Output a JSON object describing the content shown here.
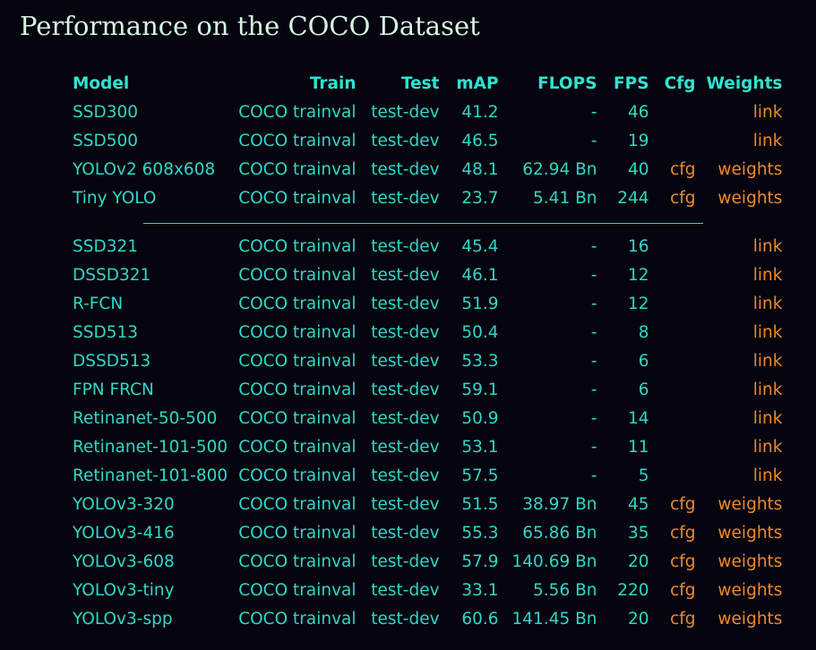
{
  "title": "Performance on the COCO Dataset",
  "headers": {
    "model": "Model",
    "train": "Train",
    "test": "Test",
    "map": "mAP",
    "flops": "FLOPS",
    "fps": "FPS",
    "cfg": "Cfg",
    "weights": "Weights"
  },
  "rows_group1": [
    {
      "model": "SSD300",
      "train": "COCO trainval",
      "test": "test-dev",
      "map": "41.2",
      "flops": "-",
      "fps": "46",
      "cfg": "",
      "weights": "link"
    },
    {
      "model": "SSD500",
      "train": "COCO trainval",
      "test": "test-dev",
      "map": "46.5",
      "flops": "-",
      "fps": "19",
      "cfg": "",
      "weights": "link"
    },
    {
      "model": "YOLOv2 608x608",
      "train": "COCO trainval",
      "test": "test-dev",
      "map": "48.1",
      "flops": "62.94 Bn",
      "fps": "40",
      "cfg": "cfg",
      "weights": "weights"
    },
    {
      "model": "Tiny YOLO",
      "train": "COCO trainval",
      "test": "test-dev",
      "map": "23.7",
      "flops": "5.41 Bn",
      "fps": "244",
      "cfg": "cfg",
      "weights": "weights"
    }
  ],
  "rows_group2": [
    {
      "model": "SSD321",
      "train": "COCO trainval",
      "test": "test-dev",
      "map": "45.4",
      "flops": "-",
      "fps": "16",
      "cfg": "",
      "weights": "link"
    },
    {
      "model": "DSSD321",
      "train": "COCO trainval",
      "test": "test-dev",
      "map": "46.1",
      "flops": "-",
      "fps": "12",
      "cfg": "",
      "weights": "link"
    },
    {
      "model": "R-FCN",
      "train": "COCO trainval",
      "test": "test-dev",
      "map": "51.9",
      "flops": "-",
      "fps": "12",
      "cfg": "",
      "weights": "link"
    },
    {
      "model": "SSD513",
      "train": "COCO trainval",
      "test": "test-dev",
      "map": "50.4",
      "flops": "-",
      "fps": "8",
      "cfg": "",
      "weights": "link"
    },
    {
      "model": "DSSD513",
      "train": "COCO trainval",
      "test": "test-dev",
      "map": "53.3",
      "flops": "-",
      "fps": "6",
      "cfg": "",
      "weights": "link"
    },
    {
      "model": "FPN FRCN",
      "train": "COCO trainval",
      "test": "test-dev",
      "map": "59.1",
      "flops": "-",
      "fps": "6",
      "cfg": "",
      "weights": "link"
    },
    {
      "model": "Retinanet-50-500",
      "train": "COCO trainval",
      "test": "test-dev",
      "map": "50.9",
      "flops": "-",
      "fps": "14",
      "cfg": "",
      "weights": "link"
    },
    {
      "model": "Retinanet-101-500",
      "train": "COCO trainval",
      "test": "test-dev",
      "map": "53.1",
      "flops": "-",
      "fps": "11",
      "cfg": "",
      "weights": "link"
    },
    {
      "model": "Retinanet-101-800",
      "train": "COCO trainval",
      "test": "test-dev",
      "map": "57.5",
      "flops": "-",
      "fps": "5",
      "cfg": "",
      "weights": "link"
    },
    {
      "model": "YOLOv3-320",
      "train": "COCO trainval",
      "test": "test-dev",
      "map": "51.5",
      "flops": "38.97 Bn",
      "fps": "45",
      "cfg": "cfg",
      "weights": "weights"
    },
    {
      "model": "YOLOv3-416",
      "train": "COCO trainval",
      "test": "test-dev",
      "map": "55.3",
      "flops": "65.86 Bn",
      "fps": "35",
      "cfg": "cfg",
      "weights": "weights"
    },
    {
      "model": "YOLOv3-608",
      "train": "COCO trainval",
      "test": "test-dev",
      "map": "57.9",
      "flops": "140.69 Bn",
      "fps": "20",
      "cfg": "cfg",
      "weights": "weights"
    },
    {
      "model": "YOLOv3-tiny",
      "train": "COCO trainval",
      "test": "test-dev",
      "map": "33.1",
      "flops": "5.56 Bn",
      "fps": "220",
      "cfg": "cfg",
      "weights": "weights"
    },
    {
      "model": "YOLOv3-spp",
      "train": "COCO trainval",
      "test": "test-dev",
      "map": "60.6",
      "flops": "141.45 Bn",
      "fps": "20",
      "cfg": "cfg",
      "weights": "weights"
    }
  ],
  "colors": {
    "background": "#05040f",
    "text": "#32d6c8",
    "header": "#2fe3d0",
    "title": "#d6f3e4",
    "link": "#ec8a2c"
  }
}
